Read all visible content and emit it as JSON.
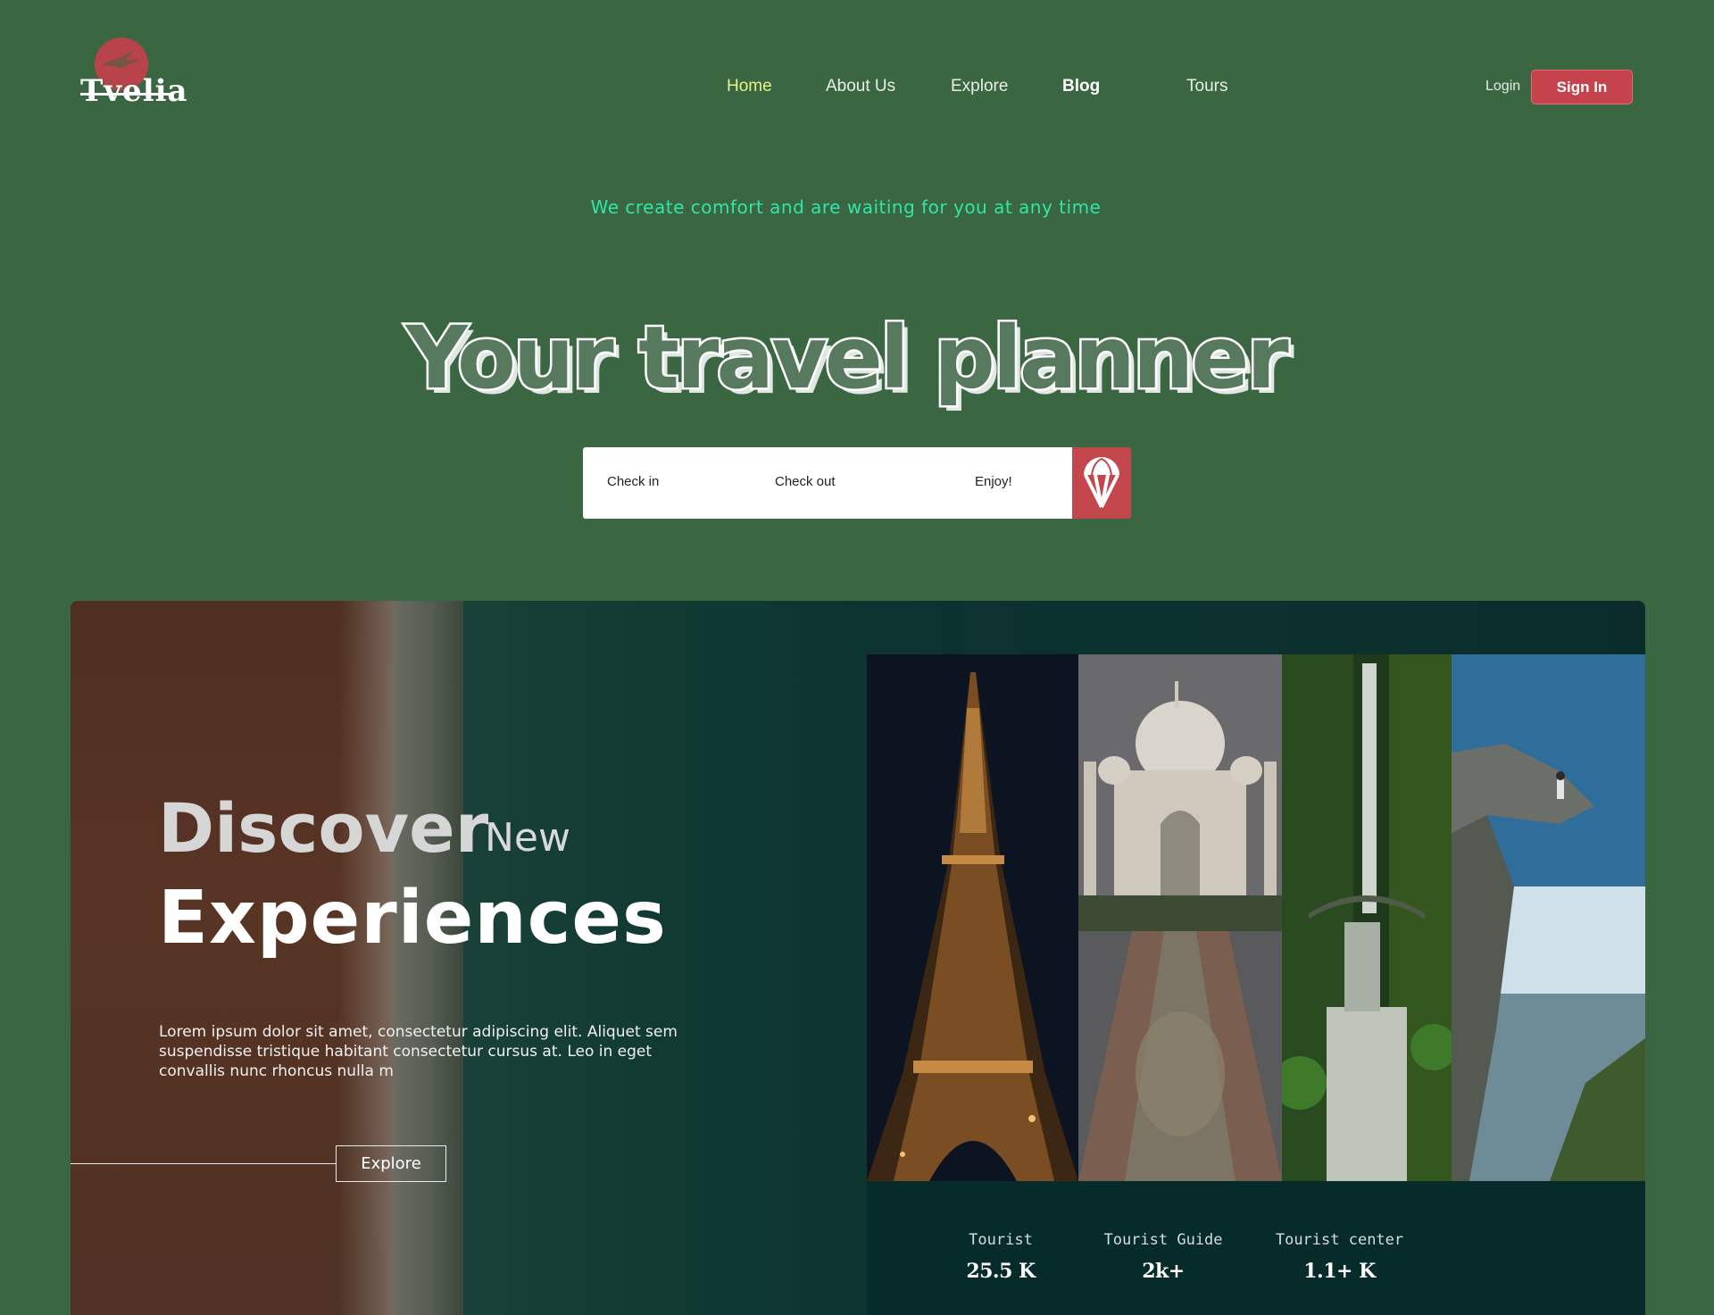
{
  "brand": {
    "name": "Tvelia",
    "accent": "#c5434d"
  },
  "nav": {
    "items": [
      {
        "label": "Home"
      },
      {
        "label": "About Us"
      },
      {
        "label": "Explore"
      },
      {
        "label": "Blog"
      },
      {
        "label": "Tours"
      }
    ],
    "login_label": "Login",
    "signin_label": "Sign In"
  },
  "hero": {
    "tagline": "We create comfort and are waiting for you at any time",
    "headline": "Your travel planner",
    "search": {
      "check_in": "Check in",
      "check_out": "Check out",
      "enjoy": "Enjoy!",
      "button_icon": "parachute-icon"
    }
  },
  "feature": {
    "discover": "Discover",
    "new": "New",
    "experiences": "Experiences",
    "description": "Lorem ipsum dolor sit amet, consectetur adipiscing elit. Aliquet sem suspendisse tristique habitant consectetur cursus at. Leo in eget convallis nunc rhoncus nulla m",
    "explore_label": "Explore",
    "photos": [
      "eiffel-tower",
      "taj-mahal",
      "waterfall",
      "cliff-hiker"
    ],
    "stats": [
      {
        "label": "Tourist",
        "value": "25.5 K"
      },
      {
        "label": "Tourist Guide",
        "value": "2k+"
      },
      {
        "label": "Tourist center",
        "value": "1.1+ K"
      }
    ]
  }
}
